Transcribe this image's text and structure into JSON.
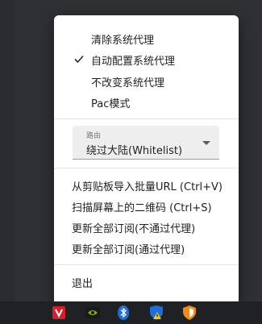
{
  "menu": {
    "proxy_modes": [
      {
        "label": "清除系统代理",
        "checked": false
      },
      {
        "label": "自动配置系统代理",
        "checked": true
      },
      {
        "label": "不改变系统代理",
        "checked": false
      },
      {
        "label": "Pac模式",
        "checked": false
      }
    ],
    "routing": {
      "caption": "路由",
      "value": "绕过大陆(Whitelist)"
    },
    "actions": [
      {
        "label": "从剪贴板导入批量URL (Ctrl+V)"
      },
      {
        "label": "扫描屏幕上的二维码 (Ctrl+S)"
      },
      {
        "label": "更新全部订阅(不通过代理)"
      },
      {
        "label": "更新全部订阅(通过代理)"
      }
    ],
    "exit_label": "退出"
  },
  "taskbar": {
    "tray_icons": [
      "v2rayn-icon",
      "nvidia-icon",
      "bluetooth-icon",
      "security-warning-icon",
      "shield-icon"
    ]
  },
  "colors": {
    "desktop_bg": "#2f3033",
    "taskbar_bg": "#202124",
    "menu_bg": "#ffffff",
    "select_bg": "#eeeeee",
    "v2rayn_red": "#d81e2b",
    "nvidia_green": "#76b900",
    "bluetooth_blue": "#1c6fd8",
    "warning_yellow": "#f5c518",
    "shield_orange": "#f08a1a"
  }
}
